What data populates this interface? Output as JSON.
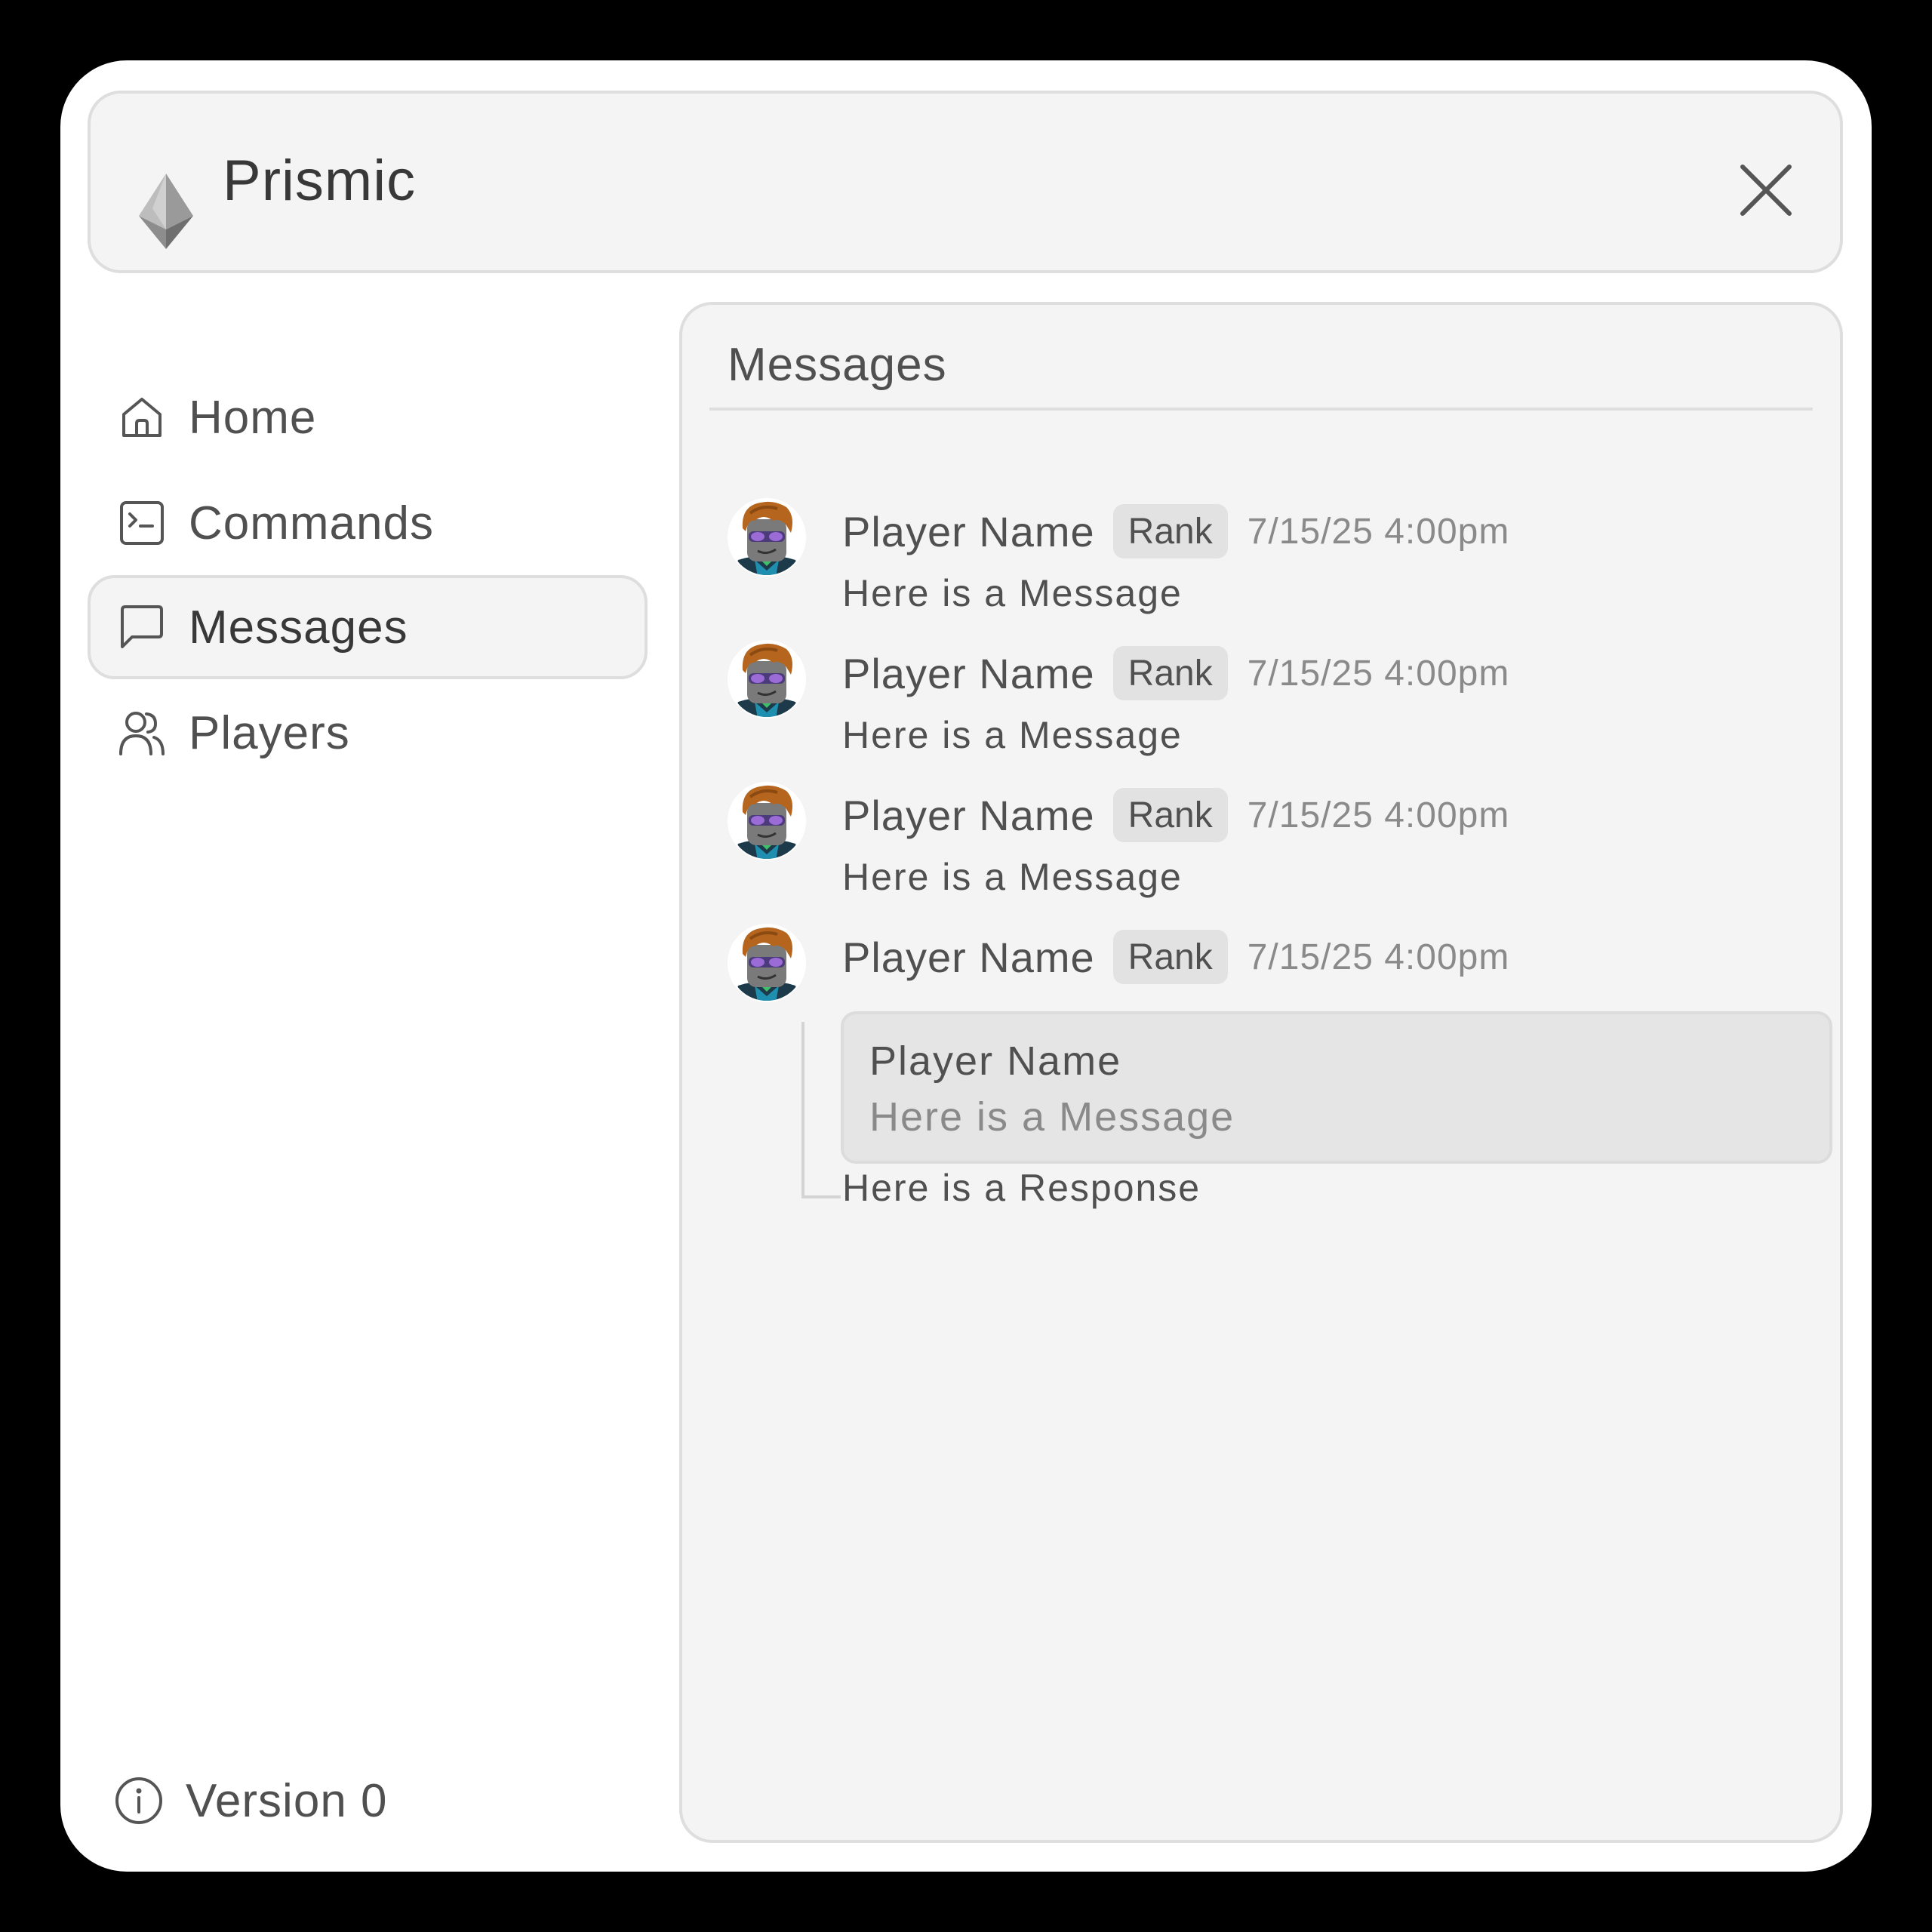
{
  "app": {
    "title": "Prismic"
  },
  "sidebar": {
    "items": [
      {
        "label": "Home",
        "icon": "home-icon"
      },
      {
        "label": "Commands",
        "icon": "terminal-icon"
      },
      {
        "label": "Messages",
        "icon": "chat-bubble-icon",
        "active": true
      },
      {
        "label": "Players",
        "icon": "users-icon"
      }
    ],
    "version": "Version 0"
  },
  "panel": {
    "title": "Messages",
    "messages": [
      {
        "player": "Player Name",
        "rank": "Rank",
        "time": "7/15/25 4:00pm",
        "text": "Here is a Message"
      },
      {
        "player": "Player Name",
        "rank": "Rank",
        "time": "7/15/25 4:00pm",
        "text": "Here is a Message"
      },
      {
        "player": "Player Name",
        "rank": "Rank",
        "time": "7/15/25 4:00pm",
        "text": "Here is a Message"
      },
      {
        "player": "Player Name",
        "rank": "Rank",
        "time": "7/15/25 4:00pm",
        "reply_to": {
          "player": "Player Name",
          "text": "Here is a Message"
        },
        "text": "Here is a Response"
      }
    ]
  },
  "colors": {
    "background": "#000000",
    "window": "#ffffff",
    "surface": "#f4f4f4",
    "border": "#dedede",
    "text": "#505050",
    "muted": "#8a8a8a"
  }
}
